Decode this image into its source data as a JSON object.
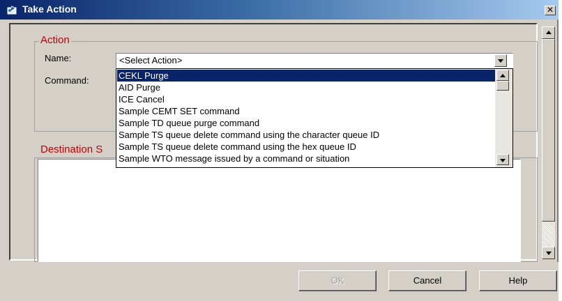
{
  "window": {
    "title": "Take Action",
    "close_glyph": "✕"
  },
  "action_group": {
    "legend": "Action",
    "name_label": "Name:",
    "command_label": "Command:",
    "selected_value": "<Select Action>"
  },
  "destination_group": {
    "legend": "Destination S"
  },
  "dropdown": {
    "items": [
      "CEKL Purge",
      "AID Purge",
      "ICE Cancel",
      "Sample CEMT SET command",
      "Sample TD queue purge command",
      "Sample TS queue delete command using the character queue ID",
      "Sample TS queue delete command using the hex queue ID",
      "Sample WTO message issued by a command or situation"
    ],
    "highlighted_index": 0
  },
  "buttons": {
    "ok": "OK",
    "cancel": "Cancel",
    "help": "Help"
  },
  "colors": {
    "legend": "#c00000",
    "selection": "#0a246a",
    "titlebar_start": "#0a246a",
    "titlebar_end": "#a6caf0"
  },
  "icons": {
    "app": "take-action-app-icon",
    "close": "close-icon",
    "dropdown": "chevron-down-icon"
  }
}
